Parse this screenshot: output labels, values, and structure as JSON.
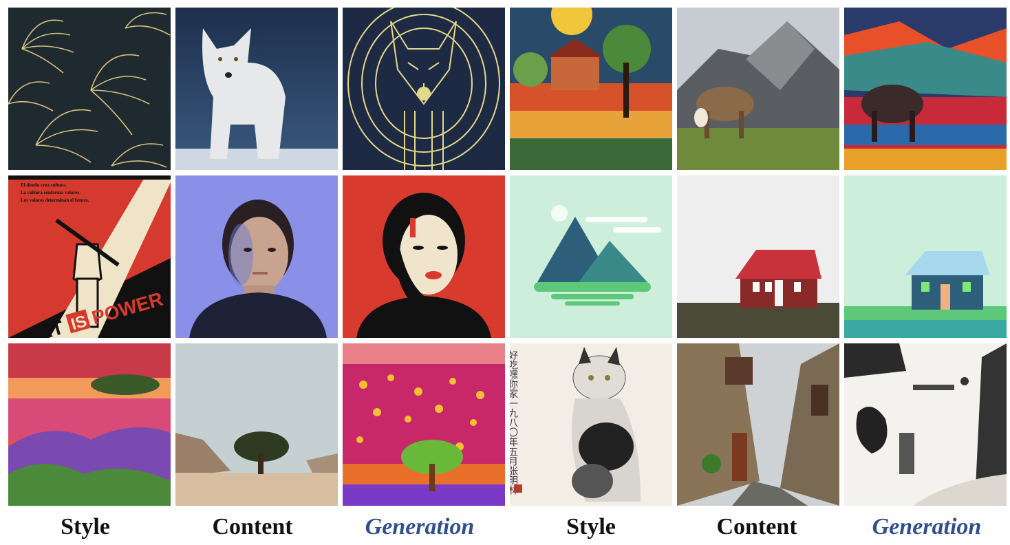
{
  "columns": [
    {
      "label": "Style",
      "kind": "style"
    },
    {
      "label": "Content",
      "kind": "content"
    },
    {
      "label": "Generation",
      "kind": "generation"
    },
    {
      "label": "Style",
      "kind": "style"
    },
    {
      "label": "Content",
      "kind": "content"
    },
    {
      "label": "Generation",
      "kind": "generation"
    }
  ],
  "poster_text": {
    "line1": "El diseño crea cultura.",
    "line2": "La cultura conforma valores.",
    "line3": "Los valores determinan el futuro.",
    "art": "ART",
    "is": "IS",
    "power": "POWER"
  },
  "calligraphy": "好吃嘿你家一九八〇年五月张明林",
  "colors": {
    "generation_label": "#2f4f8f",
    "label_text": "#111111"
  }
}
